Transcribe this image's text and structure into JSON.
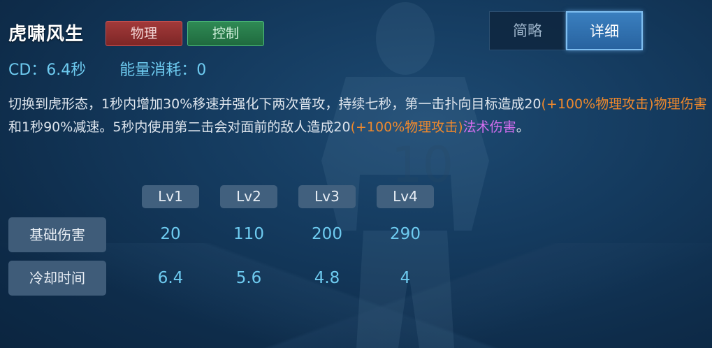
{
  "skill": {
    "name": "虎啸风生",
    "tags": [
      {
        "label": "物理",
        "color": "#a23a3a"
      },
      {
        "label": "控制",
        "color": "#2f8a55"
      }
    ],
    "cd_label": "CD：6.4秒",
    "energy_label": "能量消耗：0"
  },
  "view_toggle": {
    "brief_label": "简略",
    "detail_label": "详细",
    "selected": "详细"
  },
  "description": {
    "s1": "切换到虎形态，1秒内增加30%移速并强化下两次普攻，持续七秒，第一击扑向目标造成20",
    "s2": "(+100%物理攻击)",
    "s3": "物理伤害",
    "s4": "和1秒90%减速。5秒内使用第二击会对面前的敌人造成20",
    "s5": "(+100%物理攻击)",
    "s6": "法术伤害",
    "s7": "。",
    "colors": {
      "normal": "#dfe6ee",
      "scaling": "#f0892c",
      "physical_damage": "#f0892c",
      "magic_damage": "#d46ef0"
    }
  },
  "level_table": {
    "levels": [
      "Lv1",
      "Lv2",
      "Lv3",
      "Lv4"
    ],
    "rows": [
      {
        "label": "基础伤害",
        "values": [
          "20",
          "110",
          "200",
          "290"
        ]
      },
      {
        "label": "冷却时间",
        "values": [
          "6.4",
          "5.6",
          "4.8",
          "4"
        ]
      }
    ]
  }
}
